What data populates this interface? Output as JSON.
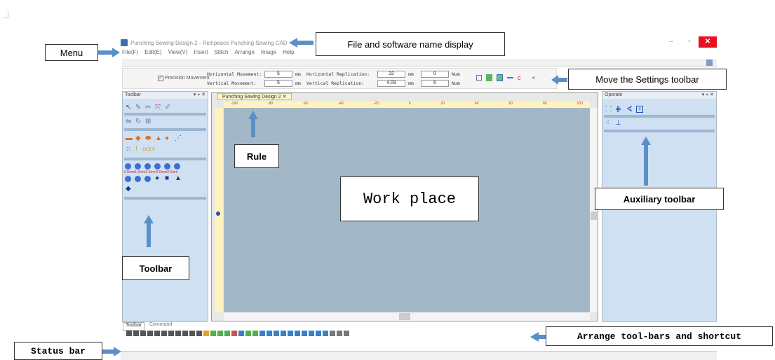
{
  "window": {
    "title": "Punching Sewing Design 2 - Richpeace Punching Sewing CAD",
    "minimize": "–",
    "maximize": "▫",
    "close": "✕"
  },
  "menu": [
    "File(F)",
    "Edit(E)",
    "View(V)",
    "Insert",
    "Stitch",
    "Arrange",
    "Image",
    "Help"
  ],
  "settings": {
    "precision": "Precision Movement",
    "h_move_label": "Horizontal Movement:",
    "v_move_label": "Vertical Movement:",
    "h_move": "5",
    "v_move": "5",
    "unit_mm": "mm",
    "h_rep_label": "Horizontal Replication:",
    "v_rep_label": "Vertical Replication:",
    "h_rep": "32",
    "v_rep": "4.09",
    "h_num": "0",
    "v_num": "6",
    "unit_num": "Num"
  },
  "left_panel": {
    "title": "Toolbar",
    "controls": "▾ ⌖ ✕",
    "circle_labels": "0.5mm1.0mm1.5mm2.0mm2.5mm",
    "tabs": [
      "Toolbar",
      "Command"
    ]
  },
  "right_panel": {
    "title": "Operate",
    "controls": "▾ ⌖ ✕"
  },
  "document_tab": "Punching Sewing Design 2",
  "ruler_marks": [
    "-100",
    "-80",
    "-60",
    "-40",
    "-20",
    "0",
    "20",
    "40",
    "60",
    "80",
    "100"
  ],
  "annotations": {
    "menu": "Menu",
    "file_name": "File and software name display",
    "settings_toolbar": "Move the Settings toolbar",
    "rule": "Rule",
    "work_place": "Work place",
    "auxiliary": "Auxiliary toolbar",
    "toolbar": "Toolbar",
    "arrange": "Arrange tool-bars and shortcut",
    "status_bar": "Status bar"
  },
  "colors": {
    "panel_blue": "#cfe0f2",
    "canvas": "#a3b8c6",
    "arrow": "#5b8fc7",
    "close_red": "#e81123"
  }
}
